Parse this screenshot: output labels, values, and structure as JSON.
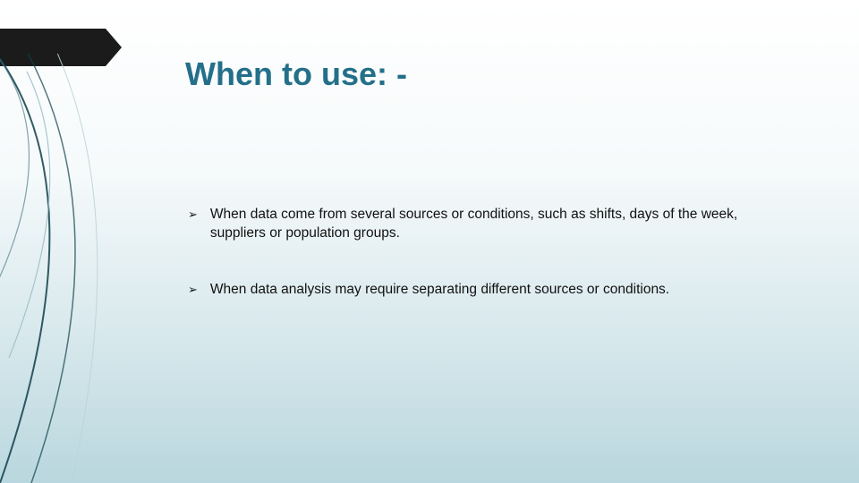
{
  "title": "When to use: -",
  "bullets": [
    "When data come from several sources or conditions, such as shifts, days of the week, suppliers or population groups.",
    "When data analysis may require separating different sources or conditions."
  ]
}
